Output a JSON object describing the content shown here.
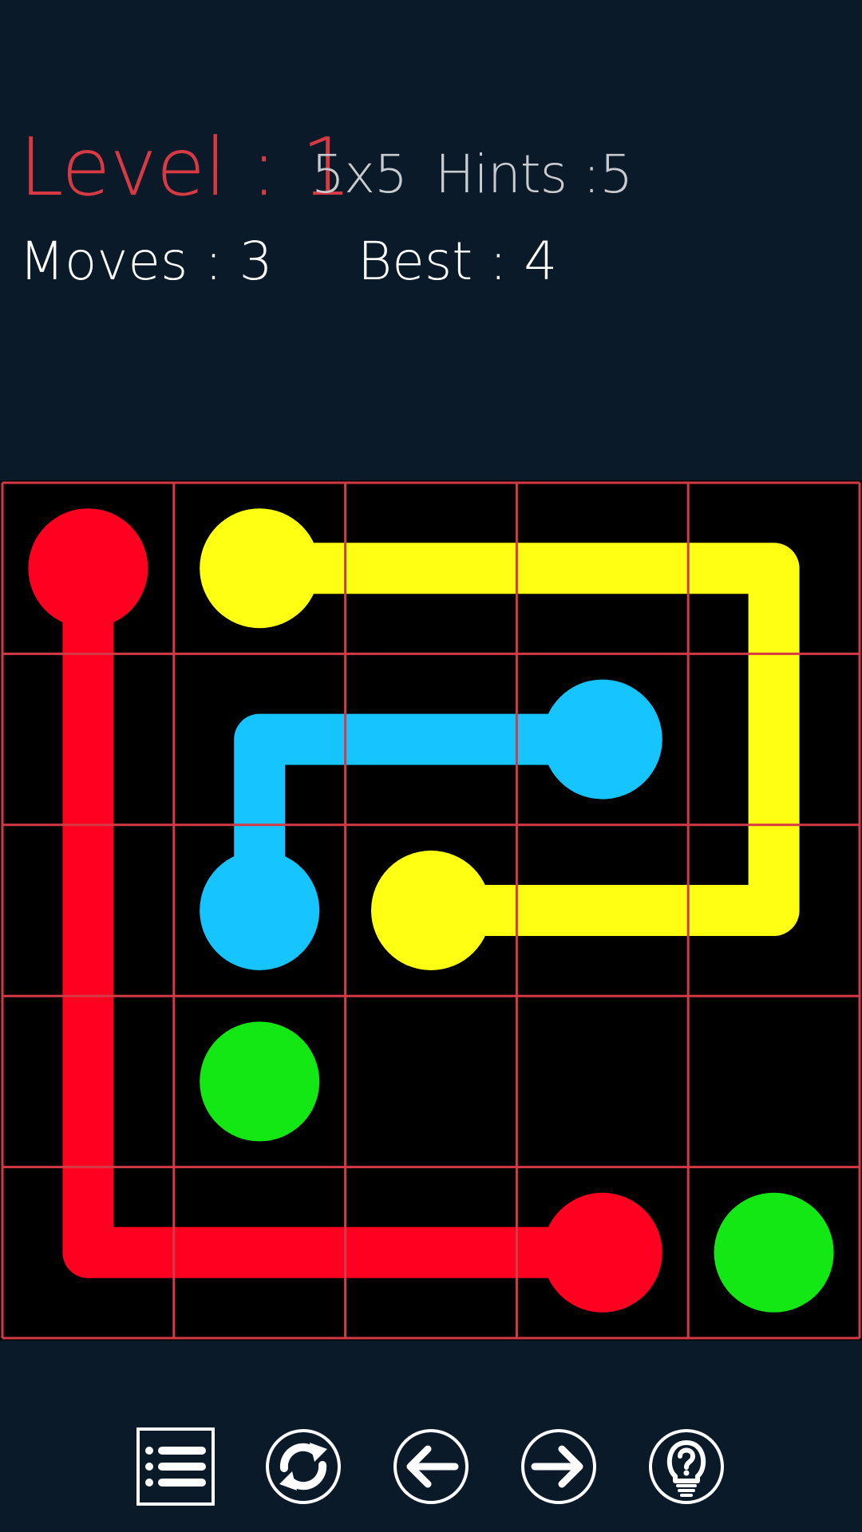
{
  "hud": {
    "level": "Level : 1",
    "size": "5x5",
    "hints": "Hints :5",
    "moves": "Moves : 3",
    "best": "Best : 4"
  },
  "colors": {
    "background": "#0a1a28",
    "board": "#000000",
    "grid": "#d43a45",
    "level_text": "#d83a44",
    "info_text": "#c8ccd0",
    "stat_text": "#ffffff",
    "red": "#ff0020",
    "yellow": "#ffff14",
    "blue": "#16c4ff",
    "green": "#14e814",
    "toolbar_icon": "#ffffff"
  },
  "board": {
    "rows": 5,
    "cols": 5,
    "dots": [
      {
        "color": "red",
        "row": 0,
        "col": 0
      },
      {
        "color": "red",
        "row": 4,
        "col": 3
      },
      {
        "color": "yellow",
        "row": 0,
        "col": 1
      },
      {
        "color": "yellow",
        "row": 2,
        "col": 2
      },
      {
        "color": "blue",
        "row": 1,
        "col": 3
      },
      {
        "color": "blue",
        "row": 2,
        "col": 1
      },
      {
        "color": "green",
        "row": 3,
        "col": 1
      },
      {
        "color": "green",
        "row": 4,
        "col": 4
      }
    ],
    "paths": [
      {
        "color": "red",
        "cells": [
          [
            0,
            0
          ],
          [
            1,
            0
          ],
          [
            2,
            0
          ],
          [
            3,
            0
          ],
          [
            4,
            0
          ],
          [
            4,
            1
          ],
          [
            4,
            2
          ],
          [
            4,
            3
          ]
        ]
      },
      {
        "color": "yellow",
        "cells": [
          [
            0,
            1
          ],
          [
            0,
            2
          ],
          [
            0,
            3
          ],
          [
            0,
            4
          ],
          [
            1,
            4
          ],
          [
            2,
            4
          ],
          [
            2,
            3
          ],
          [
            2,
            2
          ]
        ]
      },
      {
        "color": "blue",
        "cells": [
          [
            1,
            3
          ],
          [
            1,
            2
          ],
          [
            1,
            1
          ],
          [
            2,
            1
          ]
        ]
      }
    ]
  },
  "toolbar": {
    "buttons": [
      {
        "name": "level-list-button",
        "icon": "list-icon"
      },
      {
        "name": "restart-button",
        "icon": "refresh-icon"
      },
      {
        "name": "previous-level-button",
        "icon": "arrow-left-icon"
      },
      {
        "name": "next-level-button",
        "icon": "arrow-right-icon"
      },
      {
        "name": "hint-button",
        "icon": "lightbulb-question-icon"
      }
    ]
  }
}
